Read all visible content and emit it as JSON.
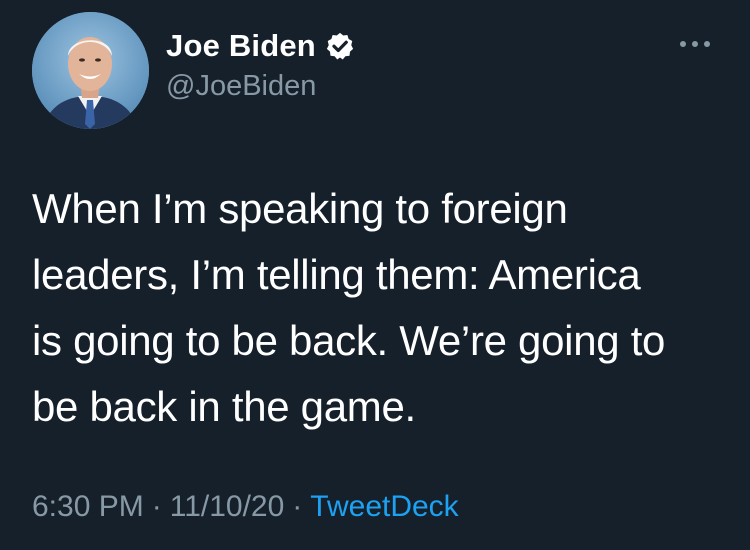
{
  "author": {
    "name": "Joe Biden",
    "handle": "@JoeBiden",
    "verified": true,
    "avatar_icon": "profile-photo"
  },
  "tweet": {
    "text_lines": [
      "When I’m speaking to foreign",
      "leaders, I’m telling them: America",
      "is going to be back. We’re going to",
      "be back in the game."
    ],
    "time": "6:30 PM",
    "date": "11/10/20",
    "separator": "·",
    "source": "TweetDeck"
  },
  "icons": {
    "verified": "verified-badge-icon",
    "more": "more-options-icon"
  },
  "colors": {
    "background": "#15202b",
    "text": "#ffffff",
    "secondary": "#8899a6",
    "accent": "#1da1f2"
  }
}
